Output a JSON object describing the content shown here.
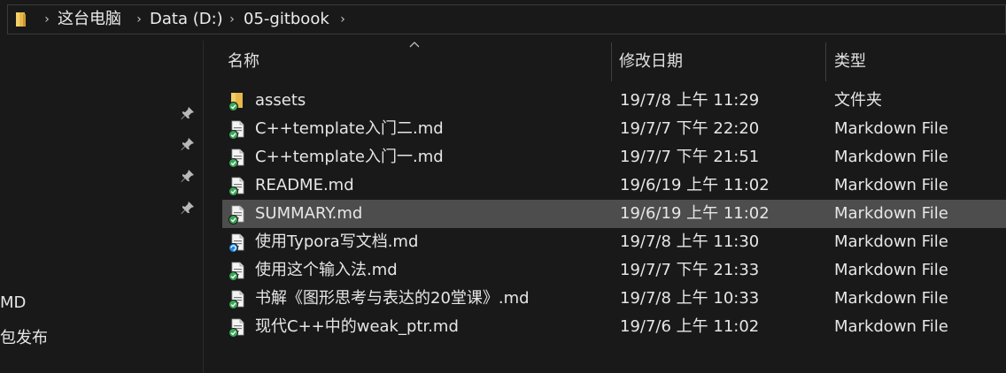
{
  "address_bar": {
    "breadcrumbs": [
      "这台电脑",
      "Data (D:)",
      "05-gitbook"
    ],
    "icon": "folder-icon"
  },
  "nav_pane": {
    "pinned_count": 4,
    "visible_items": [
      "MD",
      "包发布"
    ]
  },
  "columns": {
    "name": "名称",
    "date": "修改日期",
    "type": "类型"
  },
  "files": [
    {
      "name": "assets",
      "date": "19/7/8 上午 11:29",
      "type": "文件夹",
      "icon": "folder-icon",
      "status": "synced",
      "selected": false
    },
    {
      "name": "C++template入门二.md",
      "date": "19/7/7 下午 22:20",
      "type": "Markdown File",
      "icon": "markdown-file-icon",
      "status": "synced",
      "selected": false
    },
    {
      "name": "C++template入门一.md",
      "date": "19/7/7 下午 21:51",
      "type": "Markdown File",
      "icon": "markdown-file-icon",
      "status": "synced",
      "selected": false
    },
    {
      "name": "README.md",
      "date": "19/6/19 上午 11:02",
      "type": "Markdown File",
      "icon": "markdown-file-icon",
      "status": "synced",
      "selected": false
    },
    {
      "name": "SUMMARY.md",
      "date": "19/6/19 上午 11:02",
      "type": "Markdown File",
      "icon": "markdown-file-icon",
      "status": "synced",
      "selected": true
    },
    {
      "name": "使用Typora写文档.md",
      "date": "19/7/8 上午 11:30",
      "type": "Markdown File",
      "icon": "markdown-file-icon",
      "status": "syncing",
      "selected": false
    },
    {
      "name": "使用这个输入法.md",
      "date": "19/7/7 下午 21:33",
      "type": "Markdown File",
      "icon": "markdown-file-icon",
      "status": "synced",
      "selected": false
    },
    {
      "name": "书解《图形思考与表达的20堂课》.md",
      "date": "19/7/8 上午 10:33",
      "type": "Markdown File",
      "icon": "markdown-file-icon",
      "status": "synced",
      "selected": false
    },
    {
      "name": "现代C++中的weak_ptr.md",
      "date": "19/7/6 上午 11:02",
      "type": "Markdown File",
      "icon": "markdown-file-icon",
      "status": "synced",
      "selected": false
    }
  ],
  "colors": {
    "background": "#191919",
    "selected_row": "#4d4d4d",
    "folder": "#e8b84a",
    "sync_ok": "#3aa757",
    "sync_busy": "#1e88e5"
  }
}
